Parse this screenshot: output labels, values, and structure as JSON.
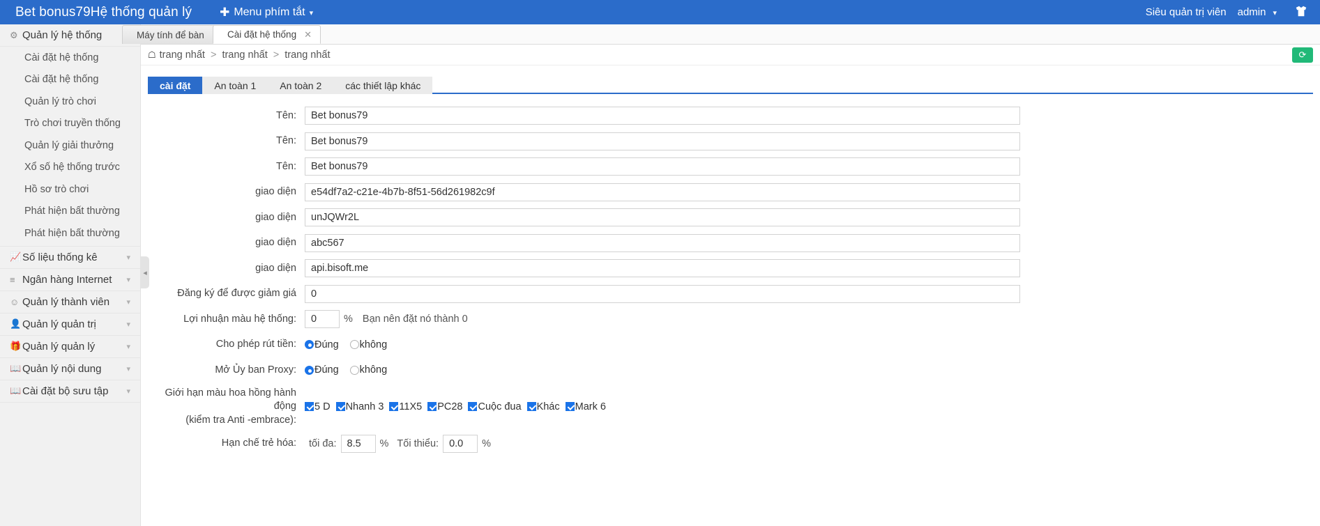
{
  "topbar": {
    "brand": "Bet bonus79Hệ thống quản lý",
    "shortcut_label": "Menu phím tắt",
    "plus_icon": "plus-icon",
    "caret_icon": "chevron-down-icon",
    "role": "Siêu quản trị viên",
    "admin": "admin",
    "admin_caret": "chevron-down-icon",
    "shirt_icon": "shirt-icon",
    "accent": "#2b6cca"
  },
  "sidebar": {
    "groups": [
      {
        "label": "Quản lý hệ thống",
        "icon": "gear-icon",
        "caret": "chevron-down-icon",
        "expanded": true,
        "items": [
          "Cài đặt hệ thống",
          "Cài đặt hệ thống",
          "Quản lý trò chơi",
          "Trò chơi truyền thống",
          "Quản lý giải thưởng",
          "Xổ số hệ thống trước",
          "Hồ sơ trò chơi",
          "Phát hiện bất thường",
          "Phát hiện bất thường"
        ]
      },
      {
        "label": "Số liệu thống kê",
        "icon": "chart-bar-icon",
        "caret": "chevron-down-icon",
        "expanded": false,
        "items": []
      },
      {
        "label": "Ngân hàng Internet",
        "icon": "list-icon",
        "caret": "chevron-down-icon",
        "expanded": false,
        "items": []
      },
      {
        "label": "Quản lý thành viên",
        "icon": "user-outline-icon",
        "caret": "chevron-down-icon",
        "expanded": false,
        "items": []
      },
      {
        "label": "Quản lý quản trị",
        "icon": "user-filled-icon",
        "caret": "chevron-down-icon",
        "expanded": false,
        "items": []
      },
      {
        "label": "Quản lý quản lý",
        "icon": "gift-icon",
        "caret": "chevron-down-icon",
        "expanded": false,
        "items": []
      },
      {
        "label": "Quản lý nội dung",
        "icon": "book-icon",
        "caret": "chevron-down-icon",
        "expanded": false,
        "items": []
      },
      {
        "label": "Cài đặt bộ sưu tập",
        "icon": "book-icon",
        "caret": "chevron-down-icon",
        "expanded": false,
        "items": []
      }
    ],
    "collapse_handle_icon": "chevron-left-icon"
  },
  "page_tabs": [
    {
      "label": "Máy tính để bàn",
      "active": false,
      "closable": false
    },
    {
      "label": "Cài đặt hệ thống",
      "active": true,
      "closable": true,
      "close_icon": "close-icon"
    }
  ],
  "breadcrumb": {
    "home_icon": "home-icon",
    "items": [
      "trang nhất",
      "trang nhất",
      "trang nhất"
    ],
    "separator": ">",
    "refresh_icon": "refresh-icon",
    "refresh_color": "#21b978"
  },
  "tabnav": [
    {
      "label": "cài đặt",
      "active": true
    },
    {
      "label": "An toàn 1",
      "active": false
    },
    {
      "label": "An toàn 2",
      "active": false
    },
    {
      "label": "các thiết lập khác",
      "active": false
    }
  ],
  "form": {
    "rows": [
      {
        "label": "Tên:",
        "value": "Bet bonus79"
      },
      {
        "label": "Tên:",
        "value": "Bet bonus79"
      },
      {
        "label": "Tên:",
        "value": "Bet bonus79"
      },
      {
        "label": "giao diện",
        "value": "e54df7a2-c21e-4b7b-8f51-56d261982c9f"
      },
      {
        "label": "giao diện",
        "value": "unJQWr2L"
      },
      {
        "label": "giao diện",
        "value": "abc567"
      },
      {
        "label": "giao diện",
        "value": "api.bisoft.me"
      },
      {
        "label": "Đăng ký để được giảm giá",
        "value": "0"
      }
    ],
    "profit": {
      "label": "Lợi nhuận màu hệ thống:",
      "value": "0",
      "percent": "%",
      "hint": "Bạn nên đặt nó thành 0"
    },
    "withdraw": {
      "label": "Cho phép rút tiền:",
      "yes": "Đúng",
      "no": "không",
      "selected": "yes"
    },
    "proxy": {
      "label": "Mở Ủy ban Proxy:",
      "yes": "Đúng",
      "no": "không",
      "selected": "yes"
    },
    "commission": {
      "label_line1": "Giới hạn màu hoa hồng hành động",
      "label_line2": "(kiểm tra Anti -embrace):",
      "options": [
        {
          "label": "5 D",
          "checked": true
        },
        {
          "label": "Nhanh 3",
          "checked": true
        },
        {
          "label": "11X5",
          "checked": true
        },
        {
          "label": "PC28",
          "checked": true
        },
        {
          "label": "Cuộc đua",
          "checked": true
        },
        {
          "label": "Khác",
          "checked": true
        },
        {
          "label": "Mark 6",
          "checked": true
        }
      ]
    },
    "rejuvenation": {
      "label": "Hạn chế trẻ hóa:",
      "max_label": "tối đa:",
      "max_value": "8.5",
      "max_percent": "%",
      "min_label": "Tối thiểu:",
      "min_value": "0.0",
      "min_percent": "%"
    }
  }
}
